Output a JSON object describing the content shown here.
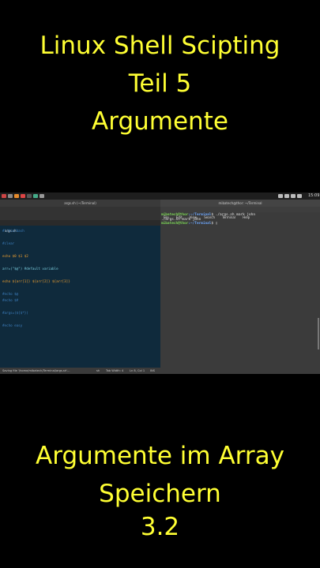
{
  "top_caption": {
    "line1": "Linux Shell Scipting",
    "line2": "Teil 5",
    "line3": "Argumente"
  },
  "bottom_caption": {
    "line1": "Argumente im Array",
    "line2": "Speichern",
    "line3": "3.2"
  },
  "tray": {
    "time": "15:09"
  },
  "editor": {
    "title": "args.sh (~/Terminal)",
    "menu": [
      "File",
      "Edit",
      "View",
      "Search",
      "Tools",
      "Documents",
      "Help"
    ],
    "tab": "args.sh",
    "code": [
      "#!/bin/bash",
      "",
      "#clear",
      "",
      "echo $0 $1 $2",
      "",
      "arr=(\"$@\") #default variable",
      "",
      "echo ${arr[1]} ${arr[2]} ${arr[3]}",
      "",
      "#echo $@",
      "#echo $#",
      "",
      "#args=(${$*})",
      "",
      "#echo easy"
    ],
    "status_left": "Saving file '/home/mibatech/Terminal/args.sh'...",
    "status_lang": "sh",
    "status_tab": "Tab Width: 4",
    "status_pos": "Ln 8, Col 1",
    "status_mode": "INS"
  },
  "terminal": {
    "title": "mibatech@thor: ~/Terminal",
    "menu": [
      "File",
      "Edit",
      "View",
      "Search",
      "Terminal",
      "Help"
    ],
    "lines": [
      {
        "user": "mibatech@thor",
        "path": ":~/Terminal",
        "cmd": "$ ./args.sh mark john"
      },
      {
        "user": "",
        "path": "",
        "cmd": "./args.sh mark john"
      },
      {
        "user": "mibatech@thor",
        "path": ":~/Terminal",
        "cmd": "$ "
      }
    ]
  }
}
